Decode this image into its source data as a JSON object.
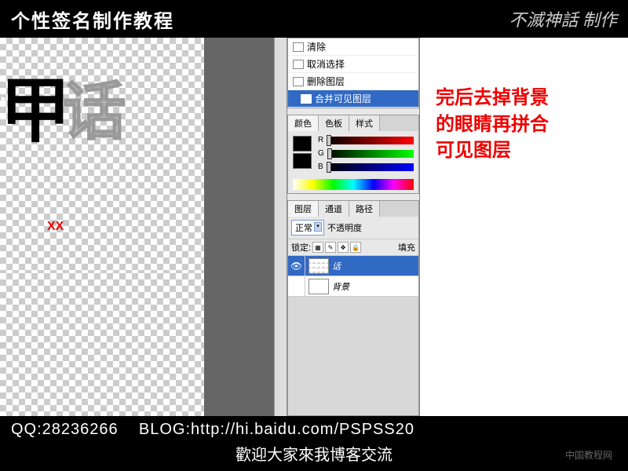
{
  "header": {
    "title": "个性签名制作教程",
    "logo": "不滅神話 制作"
  },
  "canvas": {
    "art1": "甲",
    "art2": "话",
    "xx": "XX"
  },
  "context_menu": {
    "items": [
      "清除",
      "取消选择",
      "删除图层",
      "合并可见图层"
    ],
    "selected_index": 3
  },
  "color_panel": {
    "tabs": [
      "颜色",
      "色板",
      "样式"
    ],
    "active_tab": 0,
    "channels": [
      "R",
      "G",
      "B"
    ]
  },
  "layers_panel": {
    "tabs": [
      "图层",
      "通道",
      "路径"
    ],
    "active_tab": 0,
    "blend_mode": "正常",
    "opacity_label": "不透明度",
    "lock_label": "锁定:",
    "fill_label": "填充",
    "layers": [
      {
        "name": "话",
        "visible": true,
        "selected": true
      },
      {
        "name": "背景",
        "visible": false,
        "selected": false
      }
    ]
  },
  "annotation": {
    "line1": "完后去掉背景",
    "line2": "的眼睛再拼合",
    "line3": "可见图层"
  },
  "footer": {
    "qq_label": "QQ:",
    "qq": "28236266",
    "blog_label": "BLOG:",
    "blog": "http://hi.baidu.com/PSPSS20",
    "welcome": "歡迎大家來我博客交流",
    "watermark": "中国教程网"
  }
}
